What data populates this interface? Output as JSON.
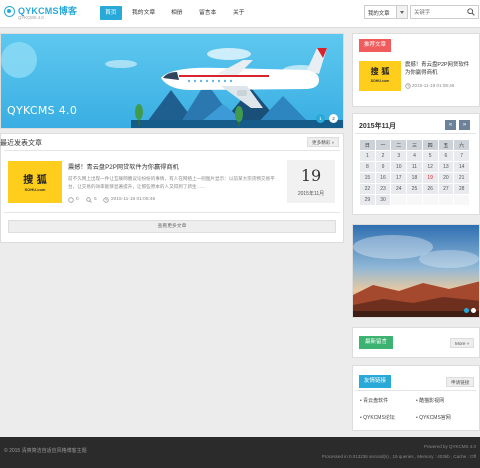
{
  "header": {
    "logo_title": "QYKCMS博客",
    "logo_version": "QYKCMS 4.0",
    "nav": [
      "首页",
      "我的文章",
      "相册",
      "留言本",
      "关于"
    ],
    "select_value": "我的文章",
    "search_placeholder": "关键字"
  },
  "banner": {
    "text": "QYKCMS 4.0",
    "slides": [
      "1",
      "2"
    ]
  },
  "recent": {
    "title": "最近发表文章",
    "more": "更多精彩 »",
    "post": {
      "title": "震撼！青云盘P2P网贷软件为你赢得商机",
      "excerpt": "前不久网上出现一件让互联网圈议论纷纷的事情，有人在网络上一则图片显示：以前某大宗货物交易平台，让交易的效率能够显著提升，让那些原本的人又得到了新生……",
      "thumb_cn": "搜 狐",
      "thumb_url": "SOHU.com",
      "comments": "0",
      "views": "5",
      "time": "2015-11-18 01:08:46",
      "day": "19",
      "year_month": "2015年11月"
    },
    "load_more": "查看更多文章"
  },
  "sidebar": {
    "recommended": {
      "tag": "推荐文章",
      "title": "震撼！青云盘P2P网贷软件为你赢得商机",
      "time": "2015-11-19 01:08:46",
      "thumb_cn": "搜 狐",
      "thumb_url": "SOHU.com"
    },
    "calendar": {
      "title": "2015年11月",
      "prev": "«",
      "next": "»",
      "weekdays": [
        "日",
        "一",
        "二",
        "三",
        "四",
        "五",
        "六"
      ],
      "weeks": [
        [
          "1",
          "2",
          "3",
          "4",
          "5",
          "6",
          "7"
        ],
        [
          "8",
          "9",
          "10",
          "11",
          "12",
          "13",
          "14"
        ],
        [
          "15",
          "16",
          "17",
          "18",
          "19",
          "20",
          "21"
        ],
        [
          "22",
          "23",
          "24",
          "25",
          "26",
          "27",
          "28"
        ],
        [
          "29",
          "30",
          "",
          "",
          "",
          "",
          ""
        ]
      ],
      "today": "19"
    },
    "guestbook": {
      "tag": "最新留言",
      "more": "More »"
    },
    "links": {
      "tag": "友情链接",
      "apply": "申请链接",
      "items": [
        "青云盘软件",
        "酷猫影视网",
        "QYKCMS论坛",
        "QYKCMS官网"
      ]
    }
  },
  "footer": {
    "left": "© 2015 清爽简洁自适应风格博客主题",
    "right1": "Powered by QYKCMS 4.0",
    "right2": "Processed in 0.013236 second(s) , 19 queries , Memory : 403kb , Cache : Off"
  },
  "colors": {
    "accent": "#29a9d8",
    "red": "#f05b5b",
    "green": "#3cb371",
    "thumb": "#ffcd1b"
  }
}
